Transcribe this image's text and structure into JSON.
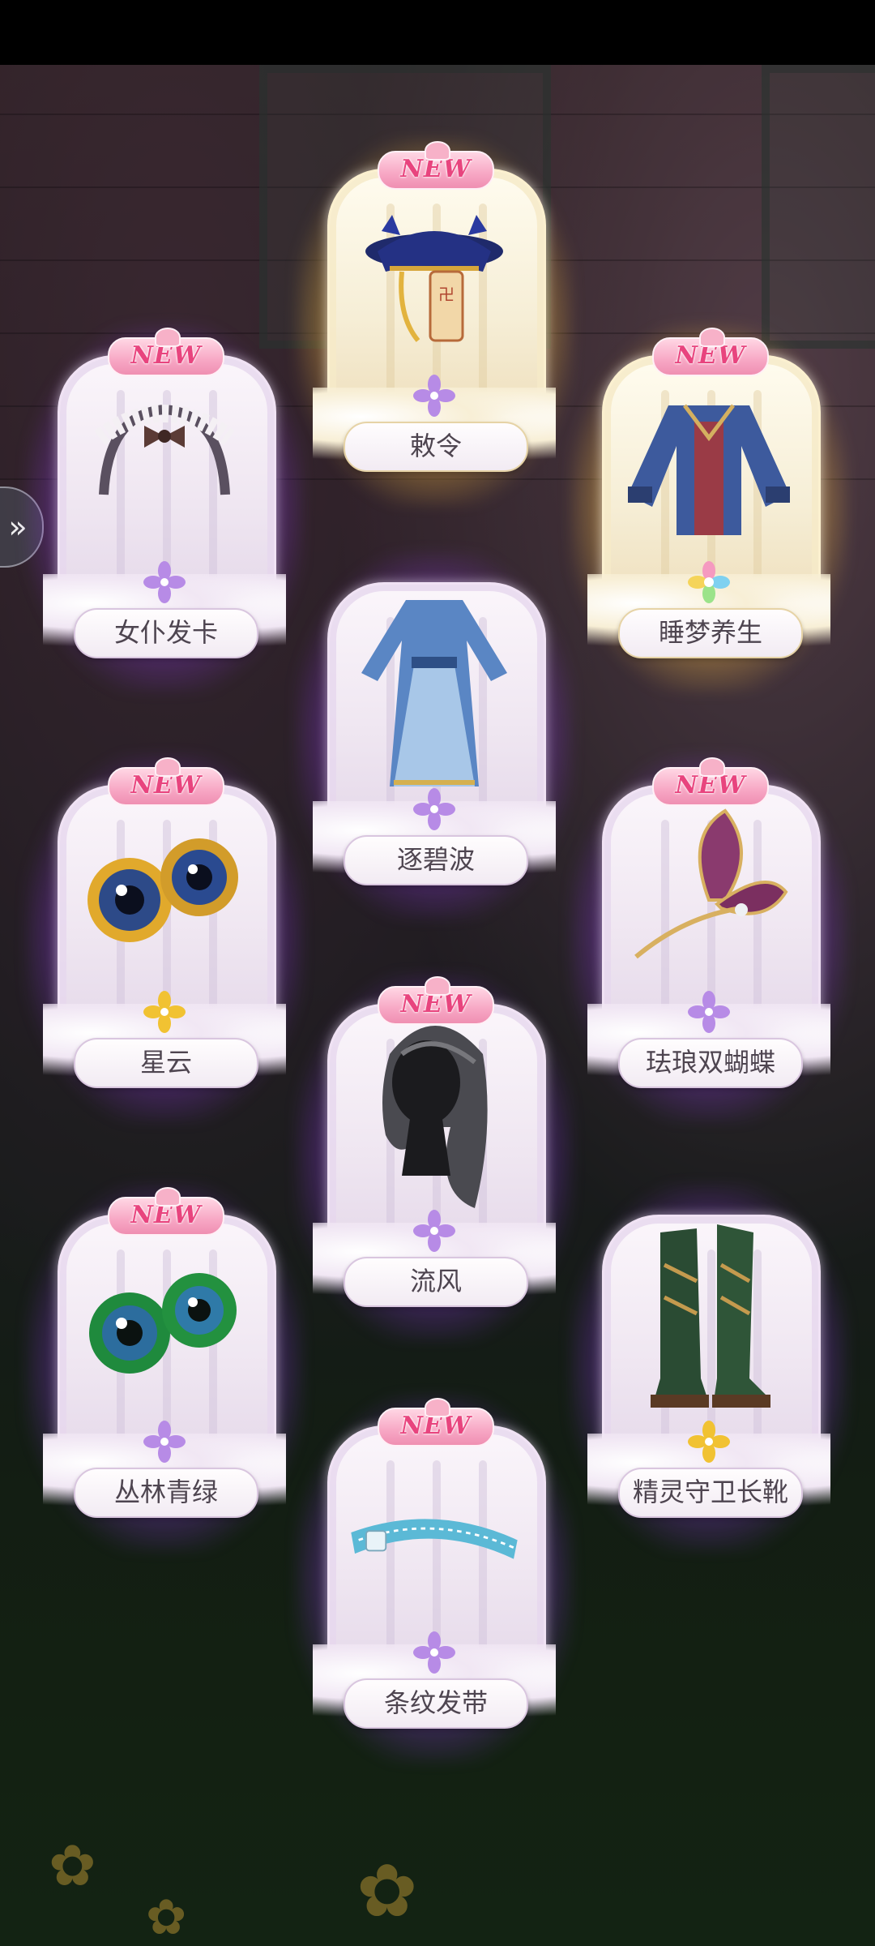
{
  "colors": {
    "purple_glow": "#a050ff",
    "gold_glow": "#ffd76e",
    "new_badge_text": "#e8447e",
    "name_text": "#4e4550",
    "star_purple": "#b78be6",
    "star_gold": "#f1c232"
  },
  "side_button": {
    "icon": "double-chevron-right-icon",
    "glyph": "»"
  },
  "new_label": "NEW",
  "cards": [
    {
      "name": "敕令",
      "rarity": "gold",
      "is_new": true,
      "star": "purple",
      "icon": "official-hat-icon"
    },
    {
      "name": "女仆发卡",
      "rarity": "purple",
      "is_new": true,
      "star": "purple",
      "icon": "maid-headband-icon"
    },
    {
      "name": "睡梦养生",
      "rarity": "gold",
      "is_new": true,
      "star": "rainbow",
      "icon": "blue-robe-coat-icon"
    },
    {
      "name": "逐碧波",
      "rarity": "purple",
      "is_new": false,
      "star": "purple",
      "icon": "blue-hanfu-dress-icon"
    },
    {
      "name": "星云",
      "rarity": "purple",
      "is_new": true,
      "star": "gold",
      "icon": "nebula-eyes-icon"
    },
    {
      "name": "珐琅双蝴蝶",
      "rarity": "purple",
      "is_new": true,
      "star": "purple",
      "icon": "butterfly-hairpin-icon"
    },
    {
      "name": "流风",
      "rarity": "purple",
      "is_new": true,
      "star": "purple",
      "icon": "gray-hair-wig-icon"
    },
    {
      "name": "丛林青绿",
      "rarity": "purple",
      "is_new": true,
      "star": "purple",
      "icon": "green-eyes-icon"
    },
    {
      "name": "精灵守卫长靴",
      "rarity": "purple",
      "is_new": false,
      "star": "gold",
      "icon": "green-boots-icon"
    },
    {
      "name": "条纹发带",
      "rarity": "purple",
      "is_new": true,
      "star": "purple",
      "icon": "striped-headband-icon"
    }
  ]
}
